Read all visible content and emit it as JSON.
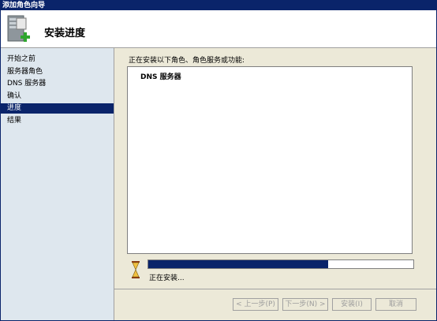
{
  "window": {
    "title": "添加角色向导"
  },
  "header": {
    "title": "安装进度"
  },
  "sidebar": {
    "items": [
      {
        "label": "开始之前",
        "active": false
      },
      {
        "label": "服务器角色",
        "active": false
      },
      {
        "label": "DNS 服务器",
        "active": false
      },
      {
        "label": "确认",
        "active": false
      },
      {
        "label": "进度",
        "active": true
      },
      {
        "label": "结果",
        "active": false
      }
    ]
  },
  "main": {
    "instruction": "正在安装以下角色、角色服务或功能:",
    "items": [
      "DNS 服务器"
    ],
    "progress_fraction": 0.68,
    "status": "正在安装..."
  },
  "buttons": {
    "prev": "< 上一步(P)",
    "next": "下一步(N) >",
    "install": "安装(I)",
    "cancel": "取消"
  },
  "colors": {
    "accent": "#0a246a",
    "sidebar_bg": "#dee7ee",
    "window_bg": "#ece9d8"
  }
}
